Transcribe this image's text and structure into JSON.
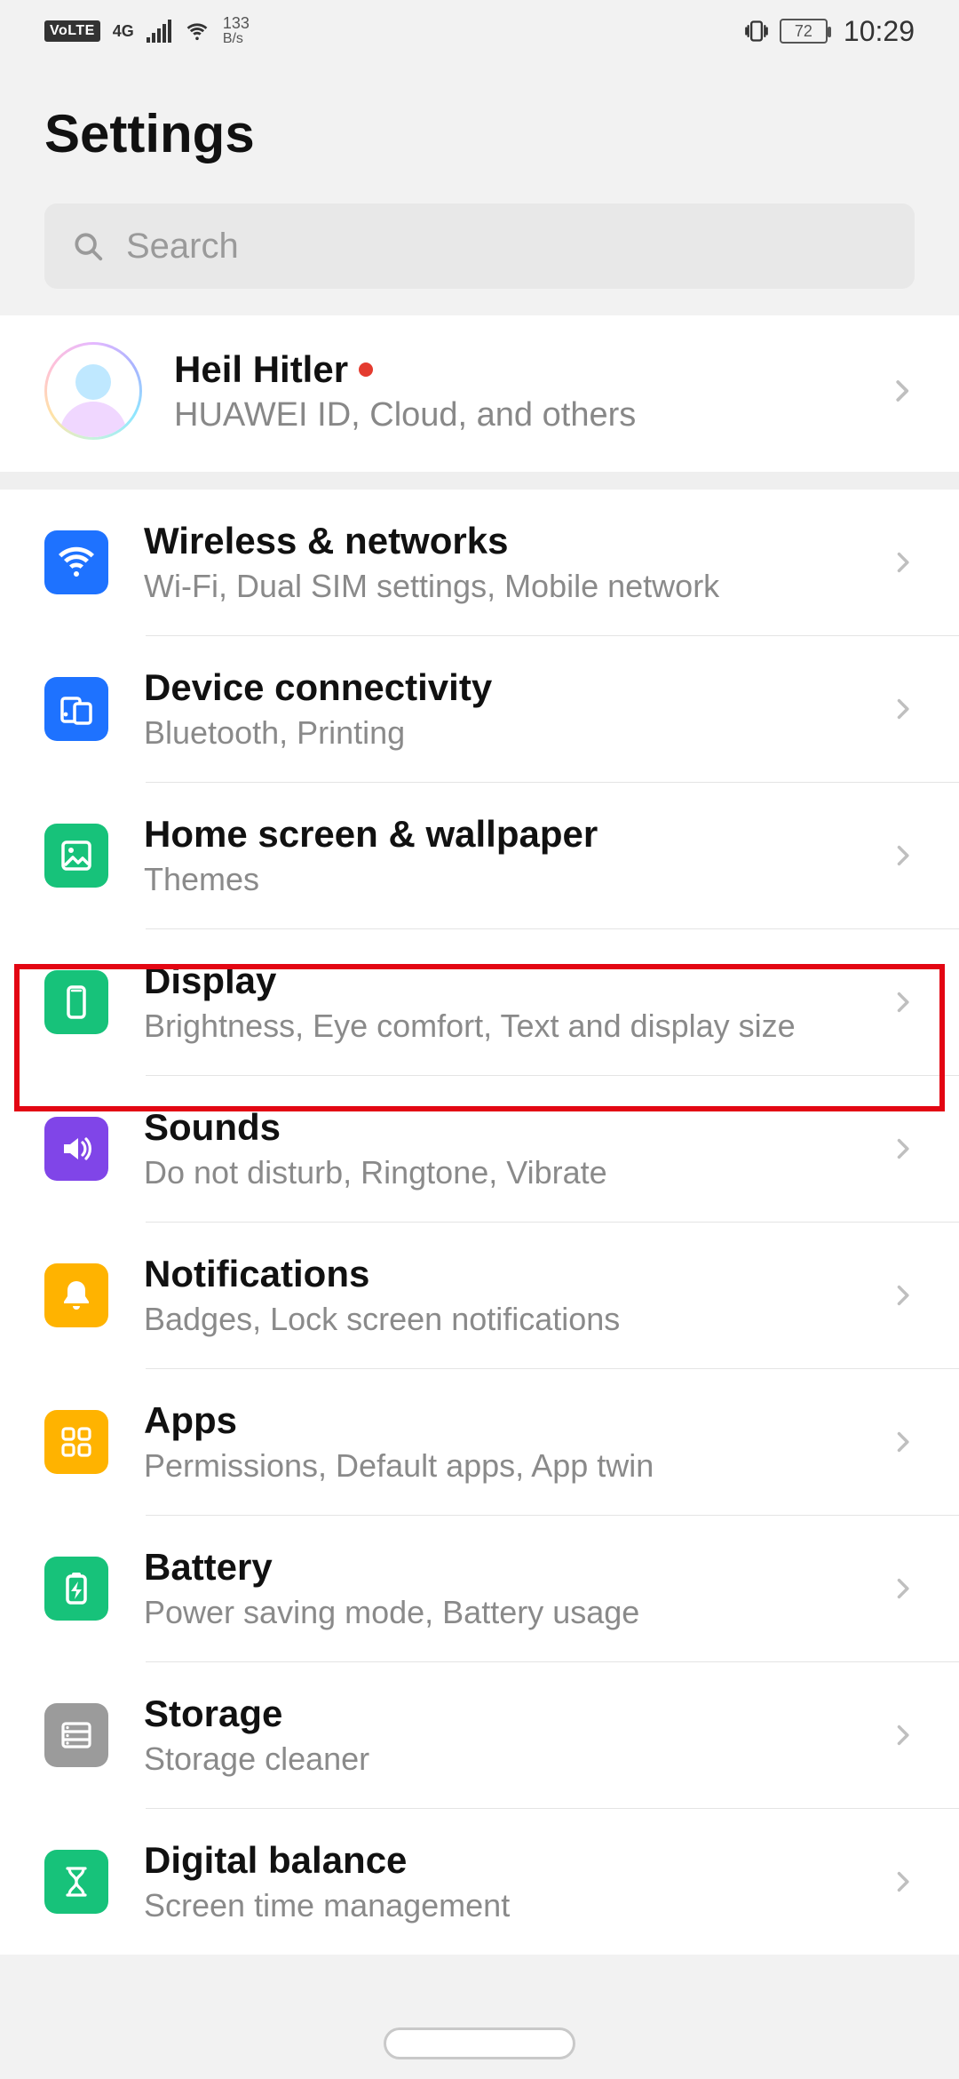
{
  "status": {
    "volte": "VoLTE",
    "network_gen": "4G",
    "data_rate_value": "133",
    "data_rate_unit": "B/s",
    "battery_pct": "72",
    "time": "10:29"
  },
  "header": {
    "title": "Settings"
  },
  "search": {
    "placeholder": "Search"
  },
  "profile": {
    "name": "Heil Hitler",
    "subtitle": "HUAWEI ID, Cloud, and others",
    "has_badge": true
  },
  "items": [
    {
      "id": "wireless",
      "title": "Wireless & networks",
      "subtitle": "Wi-Fi, Dual SIM settings, Mobile network",
      "color": "ic-blue",
      "icon": "wifi"
    },
    {
      "id": "device",
      "title": "Device connectivity",
      "subtitle": "Bluetooth, Printing",
      "color": "ic-blue",
      "icon": "devices"
    },
    {
      "id": "home",
      "title": "Home screen & wallpaper",
      "subtitle": "Themes",
      "color": "ic-green",
      "icon": "image"
    },
    {
      "id": "display",
      "title": "Display",
      "subtitle": "Brightness, Eye comfort, Text and display size",
      "color": "ic-green",
      "icon": "phone"
    },
    {
      "id": "sounds",
      "title": "Sounds",
      "subtitle": "Do not disturb, Ringtone, Vibrate",
      "color": "ic-purple",
      "icon": "sound"
    },
    {
      "id": "notif",
      "title": "Notifications",
      "subtitle": "Badges, Lock screen notifications",
      "color": "ic-amber",
      "icon": "bell"
    },
    {
      "id": "apps",
      "title": "Apps",
      "subtitle": "Permissions, Default apps, App twin",
      "color": "ic-amber",
      "icon": "grid"
    },
    {
      "id": "battery",
      "title": "Battery",
      "subtitle": "Power saving mode, Battery usage",
      "color": "ic-green",
      "icon": "battery"
    },
    {
      "id": "storage",
      "title": "Storage",
      "subtitle": "Storage cleaner",
      "color": "ic-gray",
      "icon": "storage"
    },
    {
      "id": "digital",
      "title": "Digital balance",
      "subtitle": "Screen time management",
      "color": "ic-green",
      "icon": "hourglass"
    }
  ],
  "highlighted_item_id": "display"
}
